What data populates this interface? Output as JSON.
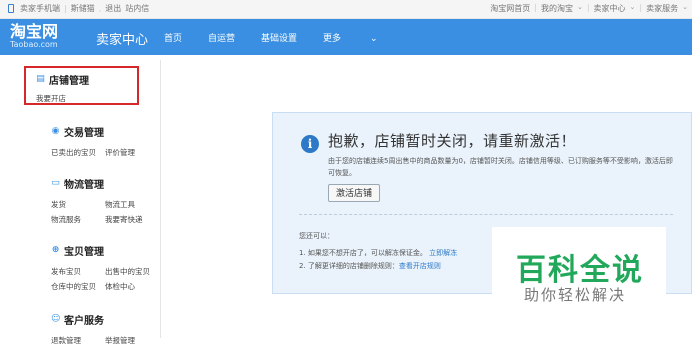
{
  "topbar": {
    "mobile": "卖家手机端",
    "user": "斯储猫",
    "logout": "退出",
    "messages": "站内信",
    "right": [
      "淘宝网首页",
      "我的淘宝",
      "卖家中心",
      "卖家服务"
    ]
  },
  "nav": {
    "logo_cn": "淘宝网",
    "logo_en": "Taobao.com",
    "title": "卖家中心",
    "menu": [
      "首页",
      "自运营",
      "基础设置",
      "更多"
    ]
  },
  "sidebar": {
    "groups": [
      {
        "title": "店铺管理",
        "icon": "store-icon",
        "links": [
          [
            "我要开店"
          ]
        ]
      },
      {
        "title": "交易管理",
        "icon": "trade-icon",
        "links": [
          [
            "已卖出的宝贝",
            "评价管理"
          ]
        ]
      },
      {
        "title": "物流管理",
        "icon": "truck-icon",
        "links": [
          [
            "发货",
            "物流工具"
          ],
          [
            "物流服务",
            "我要寄快递"
          ]
        ]
      },
      {
        "title": "宝贝管理",
        "icon": "goods-icon",
        "links": [
          [
            "发布宝贝",
            "出售中的宝贝"
          ],
          [
            "仓库中的宝贝",
            "体检中心"
          ]
        ]
      },
      {
        "title": "客户服务",
        "icon": "service-icon",
        "links": [
          [
            "退款管理",
            "举报管理"
          ]
        ]
      }
    ]
  },
  "notice": {
    "headline": "抱歉，店铺暂时关闭，请重新激活！",
    "desc": "由于您的店铺连续5周出售中的商品数量为0，店铺暂时关闭。店铺信用等级、已订购服务等不受影响，激活后即可恢复。",
    "button": "激活店铺",
    "subtitle": "您还可以：",
    "tip1": "1. 如果您不想开店了，可以解冻保证金。",
    "tip1_link": "立即解冻",
    "tip2": "2. 了解更详细的店铺删除规则：",
    "tip2_link": "查看开店规则"
  },
  "watermark": {
    "line1": "百科全说",
    "line2": "助你轻松解决"
  }
}
